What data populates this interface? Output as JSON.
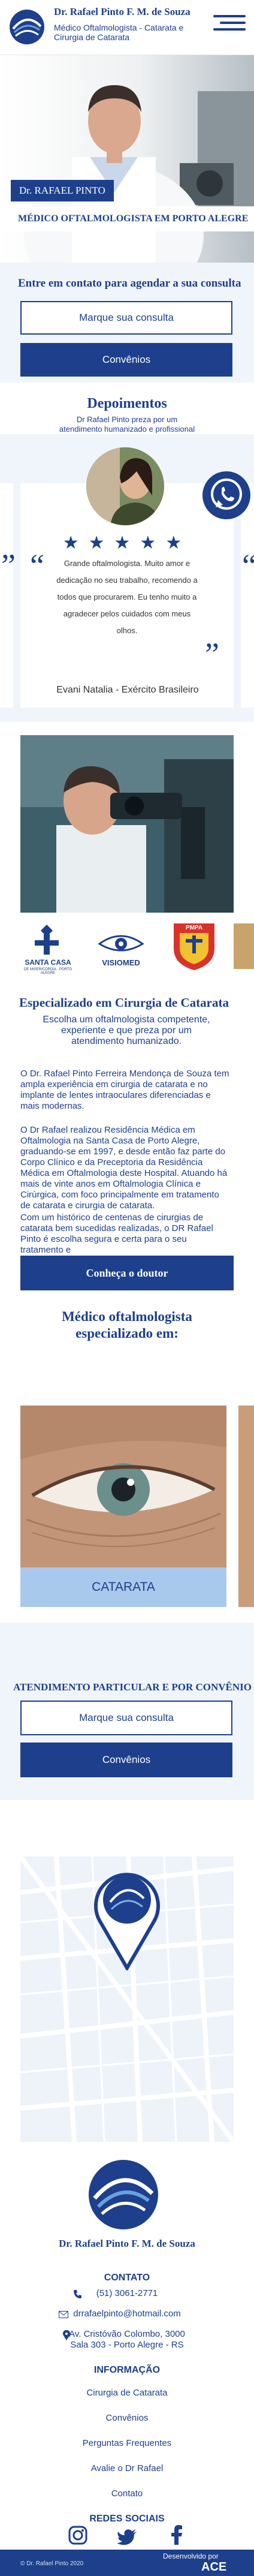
{
  "header": {
    "name": "Dr. Rafael Pinto F. M. de Souza",
    "subtitle": "Médico Oftalmologista - Catarata e Cirurgia de Catarata"
  },
  "hero": {
    "name_tag": "Dr. RAFAEL PINTO",
    "banner": "MÉDICO OFTALMOLOGISTA EM PORTO ALEGRE"
  },
  "contact": {
    "title": "Entre em contato para agendar a sua consulta",
    "consult_button": "Marque sua consulta",
    "convenios_button": "Convênios"
  },
  "testimonials": {
    "title": "Depoimentos",
    "subtitle": "Dr Rafael Pinto preza por um atendimento humanizado e profissional",
    "stars": "★★★★★",
    "quote": "Grande oftalmologista. Muito amor e dedicação no seu trabalho, recomendo a todos que procurarem. Eu tenho muito a agradecer pelos cuidados com meus olhos.",
    "author": "Evani Natalia - Exército Brasileiro",
    "quote_open": "“",
    "quote_close": "”"
  },
  "logos": {
    "santa_casa": "SANTA CASA",
    "santa_casa_sub": "DE MISERICÓRDIA · PORTO ALEGRE",
    "visiomed": "VISIOMED",
    "pmpa": "PMPA"
  },
  "specialized": {
    "title": "Especializado em Cirurgia de Catarata",
    "subtitle": "Escolha um oftalmologista competente, experiente e que preza por um atendimento humanizado.",
    "para1": "O Dr. Rafael Pinto Ferreira Mendonça de Souza tem ampla experiência em cirurgia de catarata e no implante de lentes intraoculares diferenciadas e mais modernas.",
    "para2": "O Dr Rafael realizou Residência Médica em Oftalmologia na Santa Casa de Porto Alegre, graduando-se em 1997, e desde então faz parte do Corpo Clínico e da Preceptoria da Residência Médica em Oftalmologia deste Hospital. Atuando há mais de vinte anos em Oftalmologia Clínica e Cirúrgica, com foco principalmente em tratamento de catarata e cirurgia de catarata.",
    "para3": "Com um histórico de centenas de cirurgias de catarata bem sucedidas realizadas, o DR Rafael Pinto é escolha segura e certa para o seu tratamento e",
    "button": "Conheça o doutor"
  },
  "services": {
    "title": "Médico oftalmologista especializado em:",
    "card_label": "CATARATA"
  },
  "attendance": {
    "title": "ATENDIMENTO PARTICULAR E POR CONVÊNIO",
    "consult_button": "Marque sua consulta",
    "convenios_button": "Convênios"
  },
  "footer": {
    "name": "Dr. Rafael Pinto F. M. de Souza",
    "contact_head": "CONTATO",
    "phone": "(51) 3061-2771",
    "email": "drrafaelpinto@hotmail.com",
    "address_line1": "Av. Cristóvão Colombo, 3000",
    "address_line2": "Sala 303 - Porto Alegre - RS",
    "info_head": "INFORMAÇÃO",
    "links": [
      "Cirurgia de Catarata",
      "Convênios",
      "Perguntas Frequentes",
      "Avalie o Dr Rafael",
      "Contato"
    ],
    "social_head": "REDES SOCIAIS",
    "copyright": "© Dr. Rafael Pinto 2020",
    "developed_by": "Desenvolvido por",
    "developer": "ACE"
  },
  "colors": {
    "primary": "#1d3f8c",
    "light_band": "#f0f5fb",
    "caption_blue": "#a9c9ec"
  }
}
